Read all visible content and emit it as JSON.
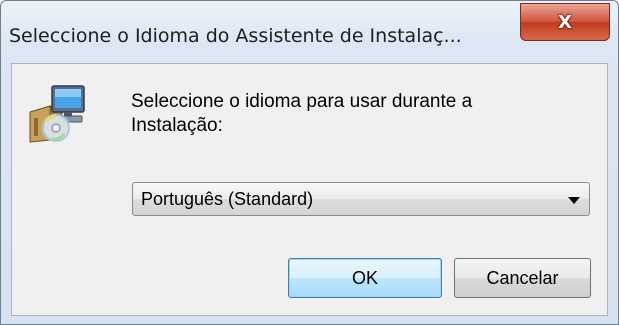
{
  "window": {
    "title": "Seleccione o Idioma do Assistente de Instalaç...",
    "close_glyph": "X",
    "close_icon": "close-icon"
  },
  "dialog": {
    "icon": "installer-computer-cd-icon",
    "prompt_line1": "Seleccione o idioma para usar durante a",
    "prompt_line2": "Instalação:",
    "language_select": {
      "selected": "Português (Standard)",
      "caret_icon": "chevron-down-icon"
    },
    "ok_label": "OK",
    "cancel_label": "Cancelar"
  },
  "colors": {
    "window_frame": "#dce7f3",
    "client_bg": "#f0f0f0",
    "close_button": "#c13a1f",
    "default_button_border": "#3c7fb1"
  }
}
